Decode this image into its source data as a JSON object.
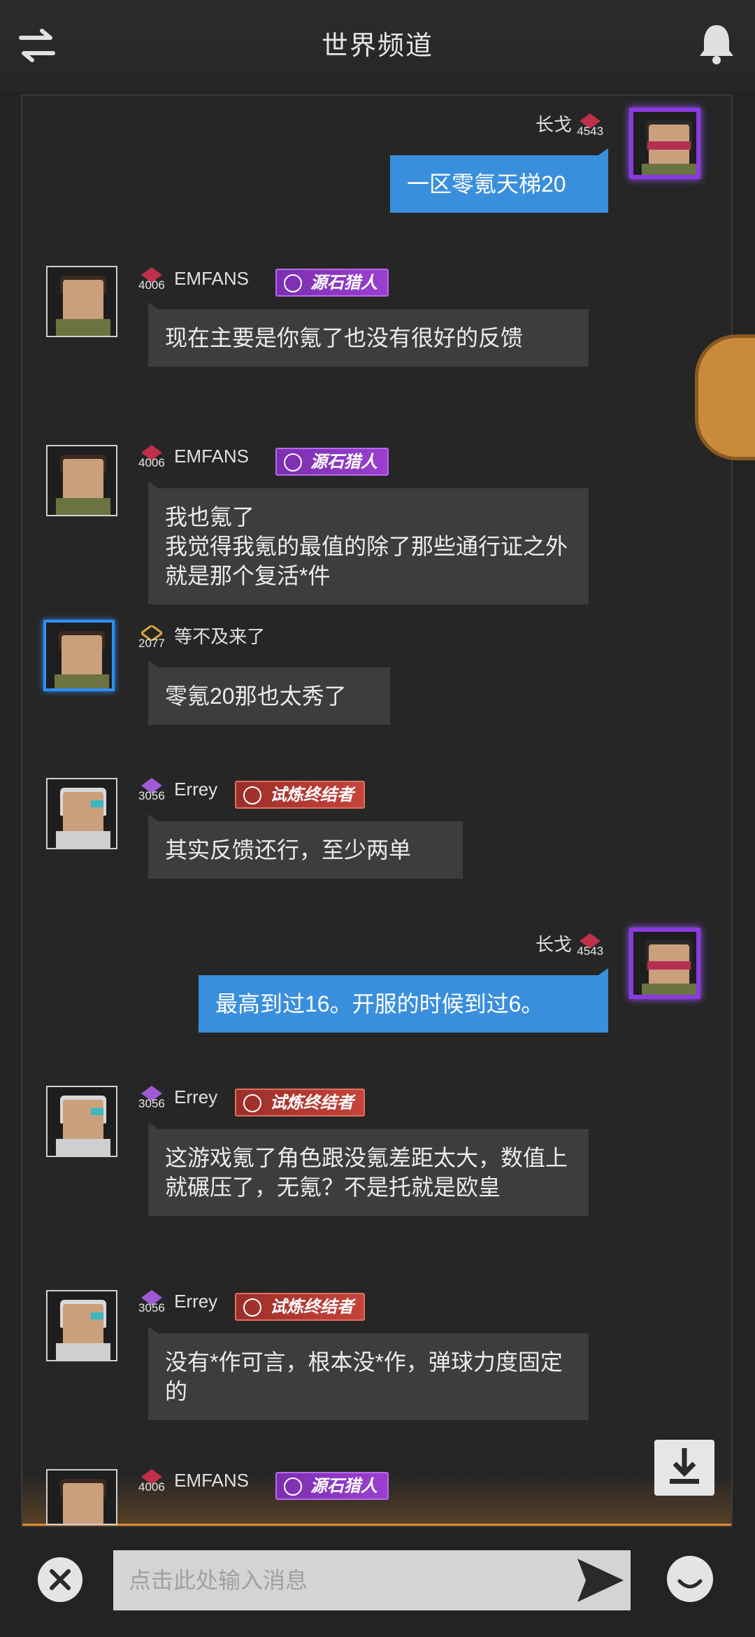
{
  "header": {
    "title": "世界频道",
    "left_icon": "swap-arrows-icon",
    "right_icon": "bell-icon"
  },
  "messages": [
    {
      "name": "长戈",
      "level": "4543",
      "mine": true,
      "text": "一区零氪天梯20"
    },
    {
      "name": "EMFANS",
      "level": "4006",
      "badge": "源石猎人",
      "text": "现在主要是你氪了也没有很好的反馈"
    },
    {
      "name": "EMFANS",
      "level": "4006",
      "badge": "源石猎人",
      "text": "我也氪了\n我觉得我氪的最值的除了那些通行证之外  就是那个复活*件"
    },
    {
      "name": "等不及来了",
      "level": "2077",
      "text": "零氪20那也太秀了"
    },
    {
      "name": "Errey",
      "level": "3056",
      "badge": "试炼终结者",
      "text": "其实反馈还行，至少两单"
    },
    {
      "name": "长戈",
      "level": "4543",
      "mine": true,
      "text": "最高到过16。开服的时候到过6。"
    },
    {
      "name": "Errey",
      "level": "3056",
      "badge": "试炼终结者",
      "text": "这游戏氪了角色跟没氪差距太大，数值上就碾压了，无氪？不是托就是欧皇"
    },
    {
      "name": "Errey",
      "level": "3056",
      "badge": "试炼终结者",
      "text": "没有*作可言，根本没*作，弹球力度固定的"
    },
    {
      "name": "EMFANS",
      "level": "4006",
      "badge": "源石猎人",
      "text": ""
    }
  ],
  "input": {
    "placeholder": "点击此处输入消息"
  },
  "colors": {
    "mine_bubble": "#3a8fdc",
    "other_bubble": "#3d3d3d",
    "badge_purple": "#8e38c4",
    "badge_red": "#b83a34",
    "accent_orange": "#e08a2c"
  }
}
